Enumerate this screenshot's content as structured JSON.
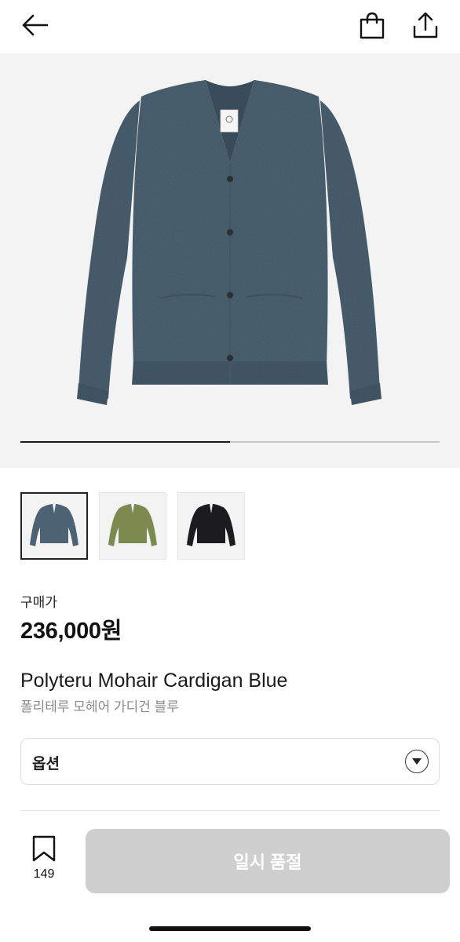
{
  "header": {
    "back_icon": "arrow-left-icon",
    "bag_icon": "shopping-bag-icon",
    "share_icon": "share-icon"
  },
  "gallery": {
    "progress_fraction": 0.5,
    "track_color": "#c8c8c8",
    "fill_color": "#1a1a1a",
    "thumbnails": [
      {
        "color": "#4d6373",
        "selected": true
      },
      {
        "color": "#7d8a4f",
        "selected": false
      },
      {
        "color": "#1c1c1e",
        "selected": false
      }
    ]
  },
  "price": {
    "label": "구매가",
    "value": "236,000원"
  },
  "product": {
    "name_en": "Polyteru Mohair Cardigan Blue",
    "name_ko": "폴리테루 모헤어 가디건 블루"
  },
  "option": {
    "label": "옵션",
    "caret_icon": "caret-down-icon"
  },
  "bottom": {
    "bookmark_icon": "bookmark-icon",
    "bookmark_count": "149",
    "cta_label": "일시 품절",
    "cta_color": "#cfcfcf"
  }
}
